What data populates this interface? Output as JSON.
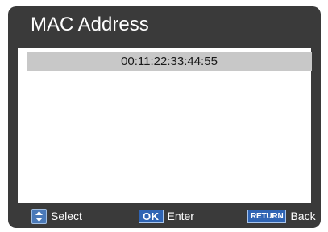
{
  "screen": {
    "title": "MAC Address"
  },
  "list": {
    "items": [
      {
        "label": "00:11:22:33:44:55",
        "selected": true
      }
    ]
  },
  "footer": {
    "select": {
      "icon": "updown-arrows-icon",
      "label": "Select"
    },
    "enter": {
      "key": "OK",
      "label": "Enter"
    },
    "back": {
      "key": "RETURN",
      "label": "Back"
    }
  },
  "colors": {
    "frame": "#3a3a3a",
    "panel": "#ffffff",
    "selection": "#c8c8c8",
    "key_blue": "#2f64b4"
  }
}
